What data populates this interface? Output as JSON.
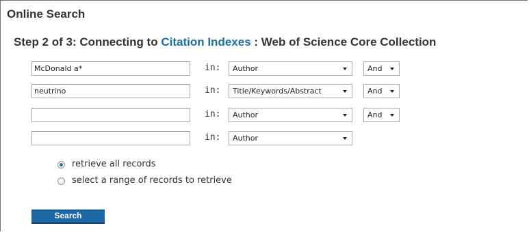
{
  "panel": {
    "title": "Online Search"
  },
  "step": {
    "prefix": "Step 2 of 3: Connecting to ",
    "link_text": "Citation Indexes",
    "suffix": " : Web of Science Core Collection"
  },
  "search_rows": [
    {
      "term": "McDonald a*",
      "in_label": "in:",
      "field": "Author",
      "operator": "And"
    },
    {
      "term": "neutrino",
      "in_label": "in:",
      "field": "Title/Keywords/Abstract",
      "operator": "And"
    },
    {
      "term": "",
      "in_label": "in:",
      "field": "Author",
      "operator": "And"
    },
    {
      "term": "",
      "in_label": "in:",
      "field": "Author"
    }
  ],
  "retrieve_options": [
    {
      "label": "retrieve all records",
      "selected": true
    },
    {
      "label": "select a range of records to retrieve",
      "selected": false
    }
  ],
  "search_button": {
    "label": "Search"
  },
  "colors": {
    "link": "#1a6fa3",
    "button": "#1d66a6"
  }
}
